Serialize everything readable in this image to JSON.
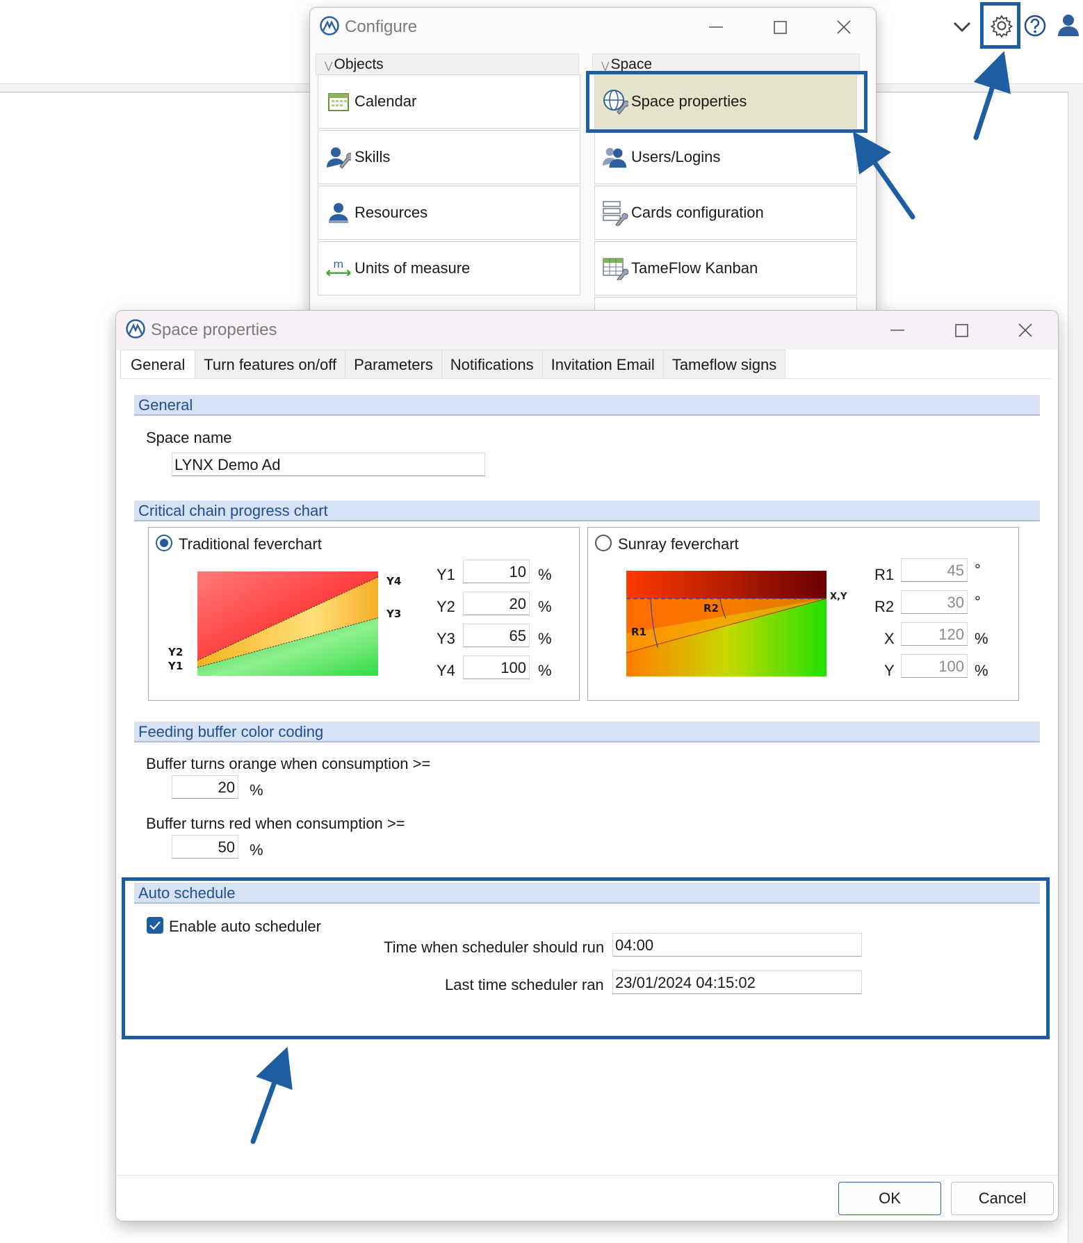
{
  "configure": {
    "title": "Configure",
    "objects_group": "Objects",
    "space_group": "Space",
    "objects": [
      {
        "label": "Calendar",
        "icon": "calendar-icon"
      },
      {
        "label": "Skills",
        "icon": "skills-icon"
      },
      {
        "label": "Resources",
        "icon": "resources-icon"
      },
      {
        "label": "Units of measure",
        "icon": "units-icon"
      }
    ],
    "space": [
      {
        "label": "Space properties",
        "icon": "globe-wrench-icon"
      },
      {
        "label": "Users/Logins",
        "icon": "users-icon"
      },
      {
        "label": "Cards configuration",
        "icon": "cards-icon"
      },
      {
        "label": "TameFlow Kanban",
        "icon": "kanban-icon"
      }
    ]
  },
  "space_properties": {
    "title": "Space properties",
    "tabs": [
      "General",
      "Turn features on/off",
      "Parameters",
      "Notifications",
      "Invitation Email",
      "Tameflow signs"
    ],
    "active_tab": "General",
    "general": {
      "header": "General",
      "space_name_label": "Space name",
      "space_name_value": "LYNX Demo Ad"
    },
    "critical_chain": {
      "header": "Critical chain progress chart",
      "traditional": {
        "label": "Traditional feverchart",
        "selected": true,
        "chart_labels": [
          "Y4",
          "Y3",
          "Y2",
          "Y1"
        ],
        "fields": [
          {
            "name": "Y1",
            "value": "10",
            "unit": "%"
          },
          {
            "name": "Y2",
            "value": "20",
            "unit": "%"
          },
          {
            "name": "Y3",
            "value": "65",
            "unit": "%"
          },
          {
            "name": "Y4",
            "value": "100",
            "unit": "%"
          }
        ]
      },
      "sunray": {
        "label": "Sunray feverchart",
        "selected": false,
        "chart_labels": [
          "X,Y",
          "R2",
          "R1"
        ],
        "fields": [
          {
            "name": "R1",
            "value": "45",
            "unit": "°"
          },
          {
            "name": "R2",
            "value": "30",
            "unit": "°"
          },
          {
            "name": "X",
            "value": "120",
            "unit": "%"
          },
          {
            "name": "Y",
            "value": "100",
            "unit": "%"
          }
        ]
      }
    },
    "feeding_buffer": {
      "header": "Feeding buffer color coding",
      "orange_label": "Buffer turns orange when consumption >=",
      "orange_value": "20",
      "red_label": "Buffer turns red when consumption >=",
      "red_value": "50",
      "unit": "%"
    },
    "auto_schedule": {
      "header": "Auto schedule",
      "enable_label": "Enable auto scheduler",
      "enabled": true,
      "time_label": "Time when scheduler should run",
      "time_value": "04:00",
      "last_label": "Last time scheduler ran",
      "last_value": "23/01/2024 04:15:02"
    },
    "ok_label": "OK",
    "cancel_label": "Cancel"
  },
  "toolbar_icons": [
    "chevron-down-icon",
    "gear-icon",
    "help-icon",
    "user-icon"
  ],
  "colors": {
    "highlight": "#1c5ea1",
    "section_bg": "#d6e2f4",
    "section_text": "#1e4f8e"
  }
}
